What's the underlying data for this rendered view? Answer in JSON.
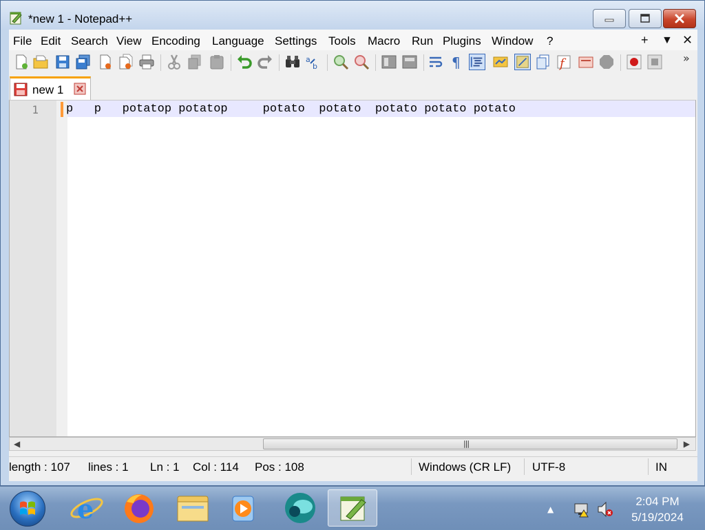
{
  "window": {
    "title": "*new 1 - Notepad++"
  },
  "menu": {
    "items": [
      "File",
      "Edit",
      "Search",
      "View",
      "Encoding",
      "Language",
      "Settings",
      "Tools",
      "Macro",
      "Run",
      "Plugins",
      "Window",
      "?"
    ],
    "right": {
      "plus": "+",
      "dropdown": "▼",
      "close": "✕"
    }
  },
  "toolbar": {
    "more": "»"
  },
  "tabs": [
    {
      "label": "new 1",
      "modified": true
    }
  ],
  "editor": {
    "line_number": "1",
    "line_text": "p   p   potatop potatop     potato  potato  potato potato potato"
  },
  "statusbar": {
    "length": "length : 107",
    "lines": "lines : 1",
    "ln": "Ln : 1",
    "col": "Col : 114",
    "pos": "Pos : 108",
    "eol": "Windows (CR LF)",
    "encoding": "UTF-8",
    "mode": "IN"
  },
  "taskbar": {
    "time": "2:04 PM",
    "date": "5/19/2024"
  },
  "colors": {
    "tab_accent": "#f7a100",
    "current_line": "#e8e8ff",
    "close_button": "#c9452b"
  }
}
